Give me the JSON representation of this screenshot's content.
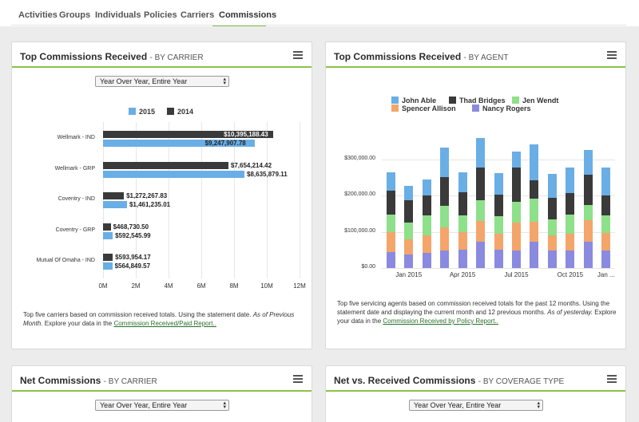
{
  "nav": {
    "tabs": [
      {
        "label": "Activities",
        "active": false
      },
      {
        "label": "Groups",
        "active": false
      },
      {
        "label": "Individuals",
        "active": false
      },
      {
        "label": "Policies",
        "active": false
      },
      {
        "label": "Carriers",
        "active": false
      },
      {
        "label": "Commissions",
        "active": true
      }
    ]
  },
  "colors": {
    "accent": "#8bc34a",
    "series_2015": "#6aaee6",
    "series_2014": "#3a3a3a",
    "link": "#2a6f2a"
  },
  "panels": {
    "top_carrier": {
      "title": "Top Commissions Received",
      "subtitle": "- BY CARRIER",
      "select_value": "Year Over Year, Entire Year",
      "desc_pre": "Top five carriers based on commission received totals. Using the statement date.",
      "desc_italic": "As of Previous Month.",
      "desc_mid": "Explore your data in the",
      "desc_link": "Commission Received/Paid Report..",
      "desc_post": ""
    },
    "top_agent": {
      "title": "Top Commissions Received",
      "subtitle": "- BY AGENT",
      "desc_pre": "Top five servicing agents based on commission received totals for the past 12 months. Using the statement date and displaying the current month and 12 previous months.",
      "desc_italic": "As of yesterday.",
      "desc_mid": "Explore your data in the",
      "desc_link": "Commission Received by Policy Report..",
      "desc_post": ""
    },
    "net_carrier": {
      "title": "Net Commissions",
      "subtitle": "- BY CARRIER",
      "select_value": "Year Over Year, Entire Year"
    },
    "net_vs_received": {
      "title": "Net vs. Received Commissions",
      "subtitle": "- BY COVERAGE TYPE",
      "select_value": "Year Over Year, Entire Year"
    }
  },
  "chart_data": [
    {
      "type": "bar",
      "orientation": "horizontal",
      "categories": [
        "Wellmark - IND",
        "Wellmark - GRP",
        "Coventry - IND",
        "Coventry - GRP",
        "Mutual Of Omaha - IND"
      ],
      "series": [
        {
          "name": "2014",
          "color": "#3a3a3a",
          "values": [
            10395188.43,
            7654214.42,
            1272267.83,
            468730.5,
            593954.17
          ],
          "labels": [
            "$10,395,188.43",
            "$7,654,214.42",
            "$1,272,267.83",
            "$468,730.50",
            "$593,954.17"
          ]
        },
        {
          "name": "2015",
          "color": "#6aaee6",
          "values": [
            9247907.78,
            8635879.11,
            1461235.01,
            592545.99,
            564849.57
          ],
          "labels": [
            "$9,247,907.78",
            "$8,635,879.11",
            "$1,461,235.01",
            "$592,545.99",
            "$564,849.57"
          ]
        }
      ],
      "legend_order": [
        "2015",
        "2014"
      ],
      "xlim": [
        0,
        12000000
      ],
      "xticks": [
        "0M",
        "2M",
        "4M",
        "6M",
        "8M",
        "10M",
        "12M"
      ],
      "xtick_values": [
        0,
        2000000,
        4000000,
        6000000,
        8000000,
        10000000,
        12000000
      ],
      "legend_position": "top",
      "grid": true
    },
    {
      "type": "bar",
      "stacked": true,
      "categories": [
        "Dec 2014",
        "Jan 2015",
        "Feb 2015",
        "Mar 2015",
        "Apr 2015",
        "May 2015",
        "Jun 2015",
        "Jul 2015",
        "Aug 2015",
        "Sep 2015",
        "Oct 2015",
        "Nov 2015",
        "Dec 2015"
      ],
      "xtick_labels": [
        {
          "label": "Jan 2015",
          "index": 1
        },
        {
          "label": "Apr 2015",
          "index": 4
        },
        {
          "label": "Jul 2015",
          "index": 7
        },
        {
          "label": "Oct 2015",
          "index": 10
        },
        {
          "label": "Jan ...",
          "index": 12
        }
      ],
      "series": [
        {
          "name": "Nancy Rogers",
          "color": "#8a8ae0",
          "values": [
            45000,
            38000,
            42000,
            48000,
            50000,
            72000,
            50000,
            48000,
            72000,
            48000,
            48000,
            72000,
            48000
          ]
        },
        {
          "name": "Spencer Allison",
          "color": "#f4a56a",
          "values": [
            55000,
            42000,
            48000,
            65000,
            50000,
            58000,
            45000,
            78000,
            55000,
            42000,
            47000,
            60000,
            48000
          ]
        },
        {
          "name": "Jen Wendt",
          "color": "#8ee08a",
          "values": [
            47000,
            45000,
            55000,
            58000,
            45000,
            58000,
            48000,
            57000,
            65000,
            45000,
            52000,
            42000,
            50000
          ]
        },
        {
          "name": "Thad Bridges",
          "color": "#3a3a3a",
          "values": [
            68000,
            62000,
            55000,
            80000,
            65000,
            90000,
            60000,
            95000,
            50000,
            60000,
            60000,
            85000,
            55000
          ]
        },
        {
          "name": "John Able",
          "color": "#6aaee6",
          "values": [
            50000,
            40000,
            45000,
            82000,
            55000,
            82000,
            60000,
            45000,
            100000,
            65000,
            70000,
            67000,
            78000
          ]
        }
      ],
      "legend_order": [
        "John Able",
        "Thad Bridges",
        "Jen Wendt",
        "Spencer Allison",
        "Nancy Rogers"
      ],
      "yticks": [
        "$0.00",
        "$100,000.00",
        "$200,000.00",
        "$300,000.00"
      ],
      "ytick_values": [
        0,
        100000,
        200000,
        300000
      ],
      "ylim": [
        0,
        375000
      ],
      "legend_position": "top",
      "grid": true
    }
  ]
}
